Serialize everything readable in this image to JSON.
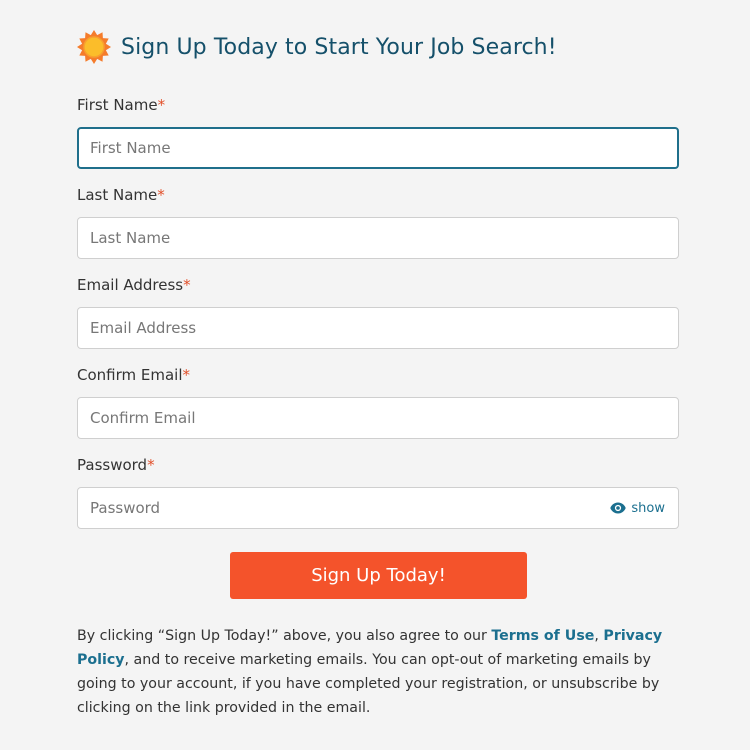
{
  "header": {
    "title": "Sign Up Today to Start Your Job Search!",
    "icon": "sun-icon",
    "icon_color": "#f57c2b",
    "title_color": "#15506a"
  },
  "form": {
    "first_name": {
      "label": "First Name",
      "required": "*",
      "placeholder": "First Name"
    },
    "last_name": {
      "label": "Last Name",
      "required": "*",
      "placeholder": "Last Name"
    },
    "email": {
      "label": "Email Address",
      "required": "*",
      "placeholder": "Email Address"
    },
    "confirm_email": {
      "label": "Confirm Email",
      "required": "*",
      "placeholder": "Confirm Email"
    },
    "password": {
      "label": "Password",
      "required": "*",
      "placeholder": "Password",
      "toggle_label": "show",
      "toggle_icon": "eye-icon"
    },
    "submit_label": "Sign Up Today!",
    "submit_color": "#f4532b"
  },
  "legal": {
    "text_1": "By clicking “Sign Up Today!” above, you also agree to our ",
    "terms_link": "Terms of Use",
    "sep": ", ",
    "privacy_link": "Privacy Policy",
    "text_2": ", and to receive marketing emails. You can opt-out of marketing emails by going to your account, if you have completed your registration, or unsubscribe by clicking on the link provided in the email.",
    "link_color": "#1b6f8f"
  }
}
